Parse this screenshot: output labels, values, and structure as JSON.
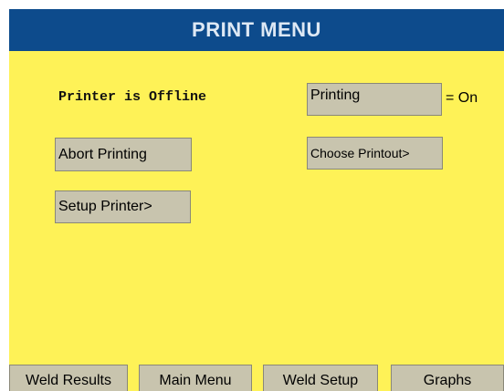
{
  "header": {
    "title": "PRINT MENU"
  },
  "status": {
    "printer_status": "Printer is Offline",
    "printing_label": "Printing",
    "printing_state": "= On"
  },
  "buttons": {
    "abort_printing": "Abort Printing",
    "choose_printout": "Choose Printout>",
    "setup_printer": "Setup Printer>"
  },
  "tabs": [
    {
      "label": "Weld Results"
    },
    {
      "label": "Main Menu"
    },
    {
      "label": "Weld Setup"
    },
    {
      "label": "Graphs"
    }
  ],
  "colors": {
    "background": "#fef257",
    "title_bar": "#0d4b8c",
    "button": "#c8c4ae"
  }
}
